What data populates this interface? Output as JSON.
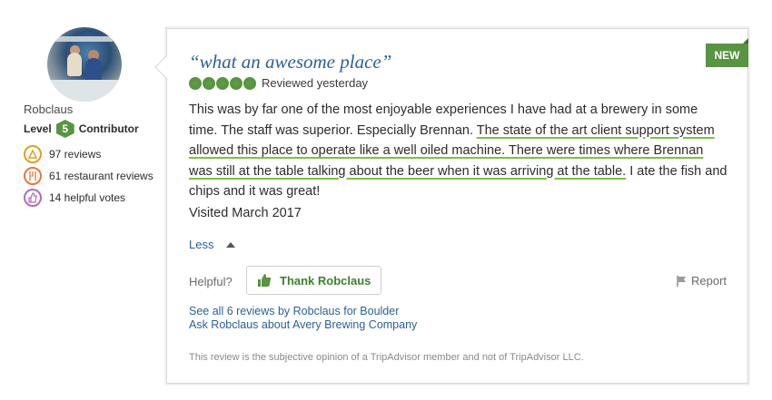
{
  "member": {
    "username": "Robclaus",
    "level_prefix": "Level",
    "level_number": "5",
    "level_suffix": "Contributor",
    "stats": [
      {
        "icon": "reviews-badge-icon",
        "text": "97 reviews",
        "color": "#d9a227"
      },
      {
        "icon": "restaurant-badge-icon",
        "text": "61 restaurant reviews",
        "color": "#e8773a"
      },
      {
        "icon": "helpful-votes-badge-icon",
        "text": "14 helpful votes",
        "color": "#b26bbf"
      }
    ]
  },
  "review": {
    "new_badge": "NEW",
    "title": "“what an awesome place”",
    "bubble_rating": 5,
    "reviewed_date": "Reviewed yesterday",
    "text_before": "This was by far one of the most enjoyable experiences I have had at a brewery in some time. The staff was superior. Especially Brennan. ",
    "text_highlight": "The state of the art client support system allowed this place to operate like a well oiled machine. There were times where Brennan was still at the table talking about the beer when it was arriving at the table.",
    "text_after": " I ate the fish and chips and it was great!",
    "visited": "Visited March 2017",
    "less_label": "Less",
    "helpful_label": "Helpful?",
    "thank_button": "Thank Robclaus",
    "report_label": "Report",
    "link_more_reviews": "See all 6 reviews by Robclaus for Boulder",
    "link_ask": "Ask Robclaus about Avery Brewing Company",
    "disclaimer": "This review is the subjective opinion of a TripAdvisor member and not of TripAdvisor LLC."
  },
  "colors": {
    "brand_green": "#589442",
    "link_blue": "#2c5f99",
    "highlight_underline": "#7cc142"
  }
}
